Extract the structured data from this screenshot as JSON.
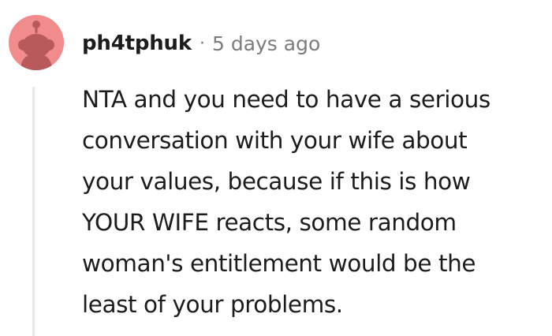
{
  "comment": {
    "username": "ph4tphuk",
    "separator": "·",
    "time": "5 days ago",
    "body_lines": [
      "NTA and you need to have a serious",
      "conversation with your wife about",
      "your values, because if this is how",
      "YOUR WIFE reacts, some random",
      "woman's entitlement would be the",
      "least of your problems."
    ]
  },
  "colors": {
    "avatar_background": "#f28b8b",
    "avatar_figure": "#b85a5c",
    "username": "#1c1c1c",
    "meta_gray": "#7c7c7c",
    "thread_line": "#e7e7e7"
  },
  "icons": {
    "avatar": "reddit-snoo-avatar-icon"
  }
}
